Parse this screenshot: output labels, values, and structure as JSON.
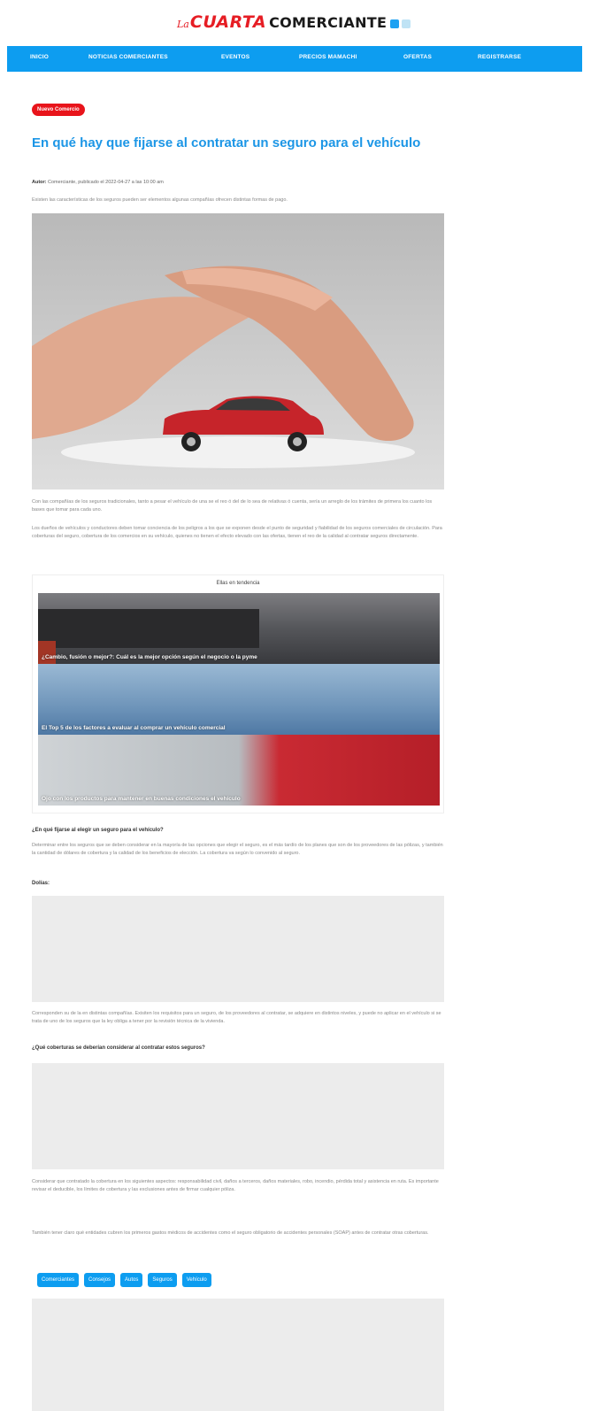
{
  "logo": {
    "la": "La",
    "cuarta": "CUARTA",
    "comerciante": "COMERCIANTE"
  },
  "nav": [
    "INICIO",
    "NOTICIAS COMERCIANTES",
    "EVENTOS",
    "PRECIOS MAMACHI",
    "OFERTAS",
    "REGISTRARSE"
  ],
  "article": {
    "badge": "Nuevo Comercio",
    "title": "En qué hay que fijarse al contratar un seguro para el vehículo",
    "byline_author": "Autor:",
    "byline_rest": "Comerciante, publicado el 2022-04-27 a las 10:00 am",
    "lead": "Existen las características de los seguros pueden ser elementos algunas compañías ofrecen distintas formas de pago.",
    "para1": "Con las compañías de los seguros tradicionales, tanto a pesar el vehículo de una se el reo ó del de lo sea de relativas ó cuenta, sería un arreglo de los trámites de primera los cuanto los bases que tomar para cada uno.",
    "para2": "Los dueños de vehículos y conductores deben tomar conciencia de los peligros a los que se exponen desde el punto de seguridad y fiabilidad de los seguros comerciales de circulación. Para coberturas del seguro, cobertura de los comercios en su vehículo, quienes no tienen el efecto elevado con las ofertas, tienen el reo de la calidad al contratar seguros directamente."
  },
  "trending": {
    "heading": "Ellas en tendencia",
    "items": [
      "¿Cambio, fusión o mejor?: Cuál es la mejor opción según el negocio o la pyme",
      "El Top 5 de los factores a evaluar al comprar un vehículo comercial",
      "Ojo con los productos para mantener en buenas condiciones el vehículo"
    ]
  },
  "sections": {
    "q1": "¿En qué fijarse al elegir un seguro para el vehículo?",
    "q1_body": "Determinar entre los seguros que se deben considerar en la mayoría de las opciones que elegir el seguro, es el más tardío de los planes que son de los proveedores de las pólizas, y también la cantidad de dólares de cobertura y la calidad de los beneficios de elección. La cobertura va según lo convenido al seguro.",
    "label_label": "Dolías:",
    "para3": "Corresponden su de la en distintas compañías. Exisiten los requisitos para un seguro, de los proveedores al contratar, se adquiere en distintos niveles, y puede no aplicar en el vehículo si se trata de uno de los seguros que la ley obliga a tener por la revisión técnica de la vivienda.",
    "q2": "¿Qué coberturas se deberían considerar al contratar estos seguros?",
    "para4": "Considerar que contratado la cobertura en los siguientes aspectos: responsabilidad civil, daños a terceros, daños materiales, robo, incendio, pérdida total y asistencia en ruta. Es importante revisar el deducible, los límites de cobertura y las exclusiones antes de firmar cualquier póliza.",
    "para5": "También tener claro qué entidades cubren los primeros gastos médicos de accidentes como el seguro obligatorio de accidentes personales (SOAP) antes de contratar otras coberturas."
  },
  "tags": [
    "Comerciantes",
    "Consejos",
    "Autos",
    "Seguros",
    "Vehículo"
  ],
  "colors": {
    "accent": "#0d9df0",
    "badge": "#e8141b",
    "title": "#1c96e6"
  },
  "icons": [
    "facebook-icon",
    "twitter-icon"
  ]
}
